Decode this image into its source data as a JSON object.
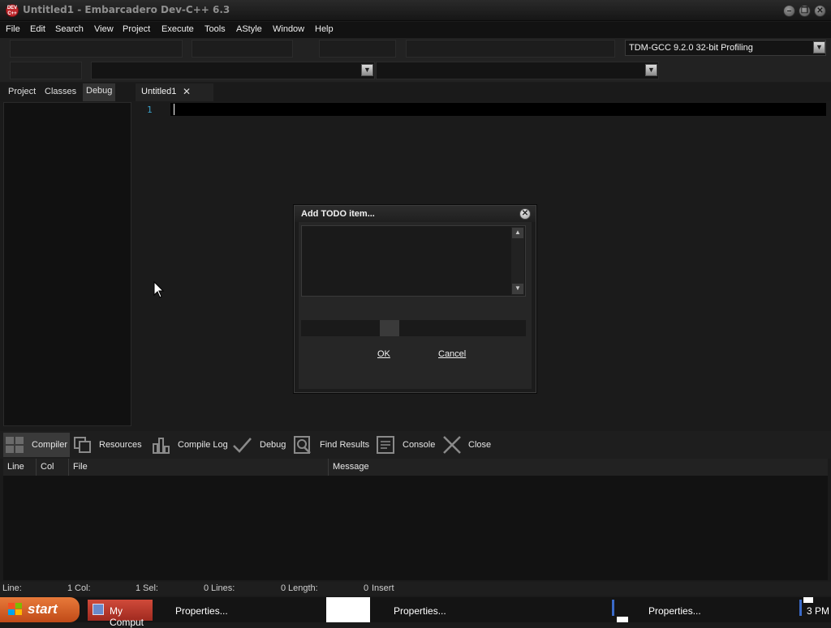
{
  "window": {
    "title": "Untitled1 - Embarcadero Dev-C++ 6.3",
    "app_icon": "dev-cpp-icon"
  },
  "menu": [
    "File",
    "Edit",
    "Search",
    "View",
    "Project",
    "Execute",
    "Tools",
    "AStyle",
    "Window",
    "Help"
  ],
  "toolbar": {
    "compiler_selected": "TDM-GCC 9.2.0 32-bit Profiling"
  },
  "left_tabs": [
    "Project",
    "Classes",
    "Debug"
  ],
  "editor": {
    "tab_label": "Untitled1",
    "line_number": "1"
  },
  "bottom_tabs": [
    "Compiler",
    "Resources",
    "Compile Log",
    "Debug",
    "Find Results",
    "Console",
    "Close"
  ],
  "messages": {
    "columns": [
      "Line",
      "Col",
      "File",
      "Message"
    ]
  },
  "status": {
    "line_label": "Line:",
    "line_value": "1",
    "col_label": "Col:",
    "col_value": "1",
    "sel_label": "Sel:",
    "sel_value": "0",
    "lines_label": "Lines:",
    "lines_value": "0",
    "length_label": "Length:",
    "length_value": "0",
    "mode": "Insert"
  },
  "taskbar": {
    "start_label": "start",
    "items": [
      "My Comput",
      "Properties...",
      "Properties...",
      "Properties..."
    ],
    "clock": "3 PM"
  },
  "dialog": {
    "title": "Add TODO item...",
    "ok_label": "OK",
    "cancel_label": "Cancel"
  },
  "colors": {
    "accent_line_number": "#3aa0c8",
    "start_button": "#d8622a"
  }
}
